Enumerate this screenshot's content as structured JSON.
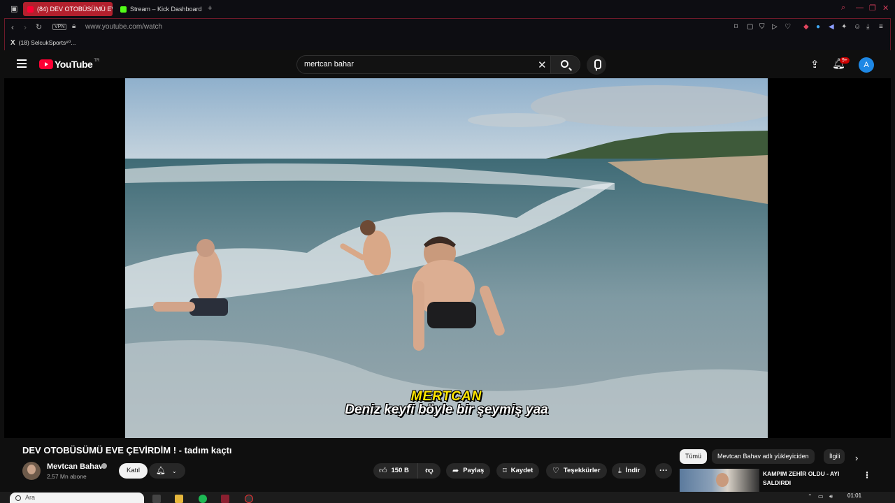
{
  "browser": {
    "tabs": [
      {
        "label": "(84) DEV OTOBÜSÜMÜ EV",
        "active": true
      },
      {
        "label": "Stream – Kick Dashboard",
        "active": false
      }
    ],
    "new_tab": "+",
    "vpn": "VPN",
    "url": "www.youtube.com/watch",
    "bookmark": "(18) SelcukSports⁸⁰..."
  },
  "youtube": {
    "logo_text": "YouTube",
    "country_code": "TR",
    "search_value": "mertcan bahar",
    "notification_count": "9+",
    "avatar_letter": "A"
  },
  "video": {
    "subtitle_name": "MERTCAN",
    "subtitle_text": "Deniz keyfi böyle bir şeymiş yaa",
    "title": "DEV OTOBÜSÜMÜ EVE ÇEVİRDİM ! - tadım kaçtı"
  },
  "channel": {
    "name": "Mevtcan Bahav",
    "subscribers": "2,57 Mn abone",
    "join_label": "Katıl"
  },
  "actions": {
    "likes": "150 B",
    "share": "Paylaş",
    "save": "Kaydet",
    "thanks": "Teşekkürler",
    "download": "İndir"
  },
  "sidebar": {
    "chips": [
      "Tümü",
      "Mevtcan Bahav adlı yükleyiciden",
      "İlgili"
    ],
    "rec_title": "KAMPIM ZEHİR OLDU - AYI SALDIRDI"
  },
  "taskbar": {
    "search_placeholder": "Ara",
    "time": "01:01"
  },
  "colors": {
    "accent_red": "#ff0033",
    "tab_active": "#b3202d",
    "bg": "#0f0f0f"
  }
}
